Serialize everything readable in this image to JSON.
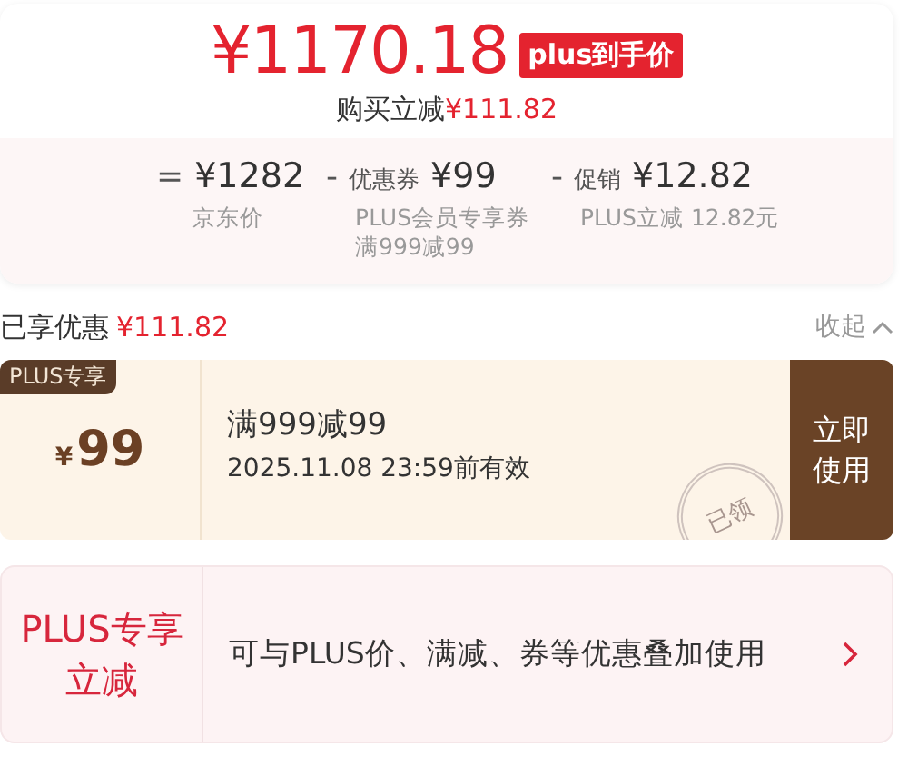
{
  "price": {
    "amount": "¥1170.18",
    "badge": "plus到手价",
    "saving_label": "购买立减",
    "saving": "¥111.82"
  },
  "breakdown": [
    {
      "operator": "=",
      "value": "¥1282",
      "note_lines": [
        "京东价"
      ]
    },
    {
      "operator": "-",
      "name": "优惠券",
      "value": "¥99",
      "note_lines": [
        "PLUS会员专享券",
        "满999减99"
      ]
    },
    {
      "operator": "-",
      "name": "促销",
      "value": "¥12.82",
      "note_lines": [
        "PLUS立减 12.82元"
      ]
    }
  ],
  "discount_header": {
    "label": "已享优惠",
    "amount": "¥111.82",
    "toggle": "收起",
    "expanded": true
  },
  "coupon": {
    "tag": "PLUS专享",
    "currency": "¥",
    "amount": "99",
    "title": "满999减99",
    "validity": "2025.11.08 23:59前有效",
    "claimed": true,
    "stamp": "已领",
    "button": "立即使用"
  },
  "promo": {
    "label": "PLUS专享立减",
    "text": "可与PLUS价、满减、券等优惠叠加使用"
  }
}
